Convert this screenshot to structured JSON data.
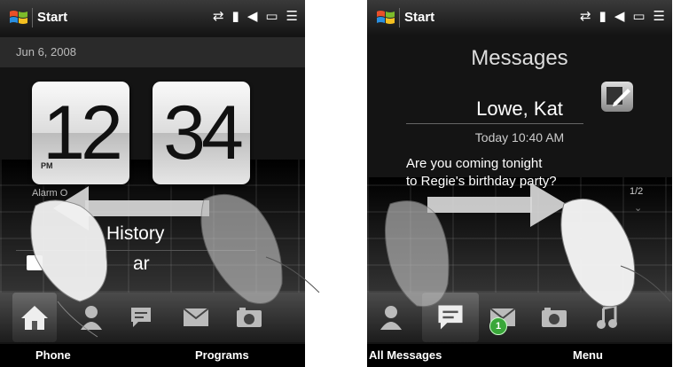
{
  "left_screen": {
    "status": {
      "start_label": "Start"
    },
    "date": "Jun 6, 2008",
    "clock": {
      "hour": "12",
      "minute": "34",
      "ampm": "PM"
    },
    "alarm_label": "Alarm O",
    "history_label": "History",
    "calendar_label": "ar",
    "tabs": [
      {
        "icon": "home-icon",
        "active": true
      },
      {
        "icon": "people-icon"
      },
      {
        "icon": "messages-icon"
      },
      {
        "icon": "mail-icon"
      },
      {
        "icon": "camera-icon"
      }
    ],
    "softkeys": {
      "left": "Phone",
      "right": "Programs"
    },
    "gesture": {
      "direction": "swipe-left",
      "arrow": "left-arrow-icon"
    }
  },
  "right_screen": {
    "status": {
      "start_label": "Start"
    },
    "title": "Messages",
    "sender": "Lowe, Kat",
    "time": "Today 10:40 AM",
    "body_lines": [
      "Are you coming tonight",
      "to Regie's birthday party?"
    ],
    "pager": "1/2",
    "mail_badge": "1",
    "tabs": [
      {
        "icon": "people-icon"
      },
      {
        "icon": "messages-icon",
        "active": true
      },
      {
        "icon": "mail-icon"
      },
      {
        "icon": "camera-icon"
      },
      {
        "icon": "music-icon"
      }
    ],
    "softkeys": {
      "left": "All Messages",
      "right": "Menu"
    },
    "gesture": {
      "direction": "swipe-right",
      "arrow": "right-arrow-icon"
    }
  },
  "colors": {
    "screen_bg": "#141414",
    "card_face": "#f0f0f0",
    "badge": "#3aa73a",
    "arrow": "#d8d8d8"
  }
}
